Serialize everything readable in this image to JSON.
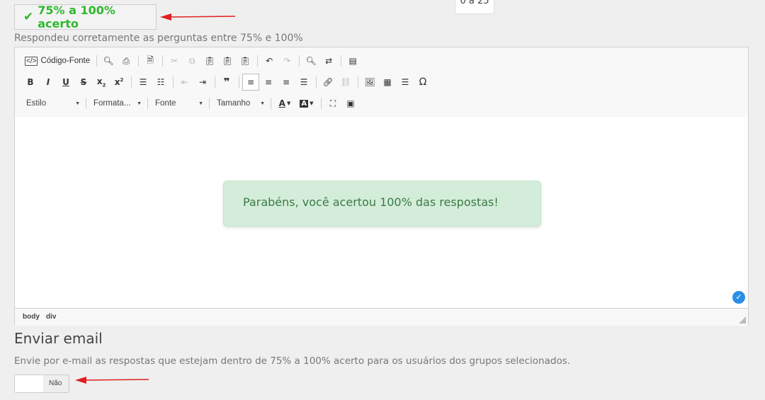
{
  "range": {
    "title": "75% a 100% acerto",
    "description": "Respondeu corretamente as perguntas entre 75% e 100%"
  },
  "tooltip": {
    "text": "0 a 25"
  },
  "toolbar": {
    "source_label": "Código-Fonte",
    "style_combo": "Estilo",
    "format_combo": "Formata...",
    "font_combo": "Fonte",
    "size_combo": "Tamanho"
  },
  "editor": {
    "content": "Parabéns, você acertou 100% das respostas!",
    "path": [
      "body",
      "div"
    ]
  },
  "send": {
    "title": "Enviar email",
    "description": "Envie por e-mail as respostas que estejam dentro de 75% a 100% acerto para os usuários dos grupos selecionados.",
    "toggle_label": "Não"
  },
  "colors": {
    "accent_green": "#2db82d",
    "alert_bg": "#d4edda",
    "arrow": "#e02020"
  }
}
